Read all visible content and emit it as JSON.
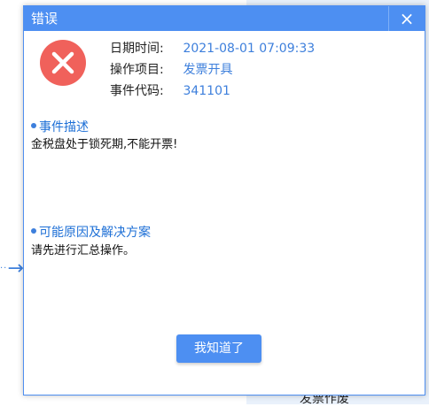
{
  "background": {
    "partial_label": "发票作废"
  },
  "dialog": {
    "title": "错误",
    "close_glyph": "×",
    "icon": "error-x-circle-icon",
    "info": {
      "datetime_label": "日期时间:",
      "datetime_value": "2021-08-01 07:09:33",
      "operation_label": "操作项目:",
      "operation_value": "发票开具",
      "event_code_label": "事件代码:",
      "event_code_value": "341101"
    },
    "description": {
      "heading": "事件描述",
      "text": "金税盘处于锁死期,不能开票!"
    },
    "solution": {
      "heading": "可能原因及解决方案",
      "text": "请先进行汇总操作。"
    },
    "ok_label": "我知道了"
  },
  "colors": {
    "accent": "#4d8ff2",
    "error": "#f0615b",
    "value_text": "#3d7fdc"
  }
}
